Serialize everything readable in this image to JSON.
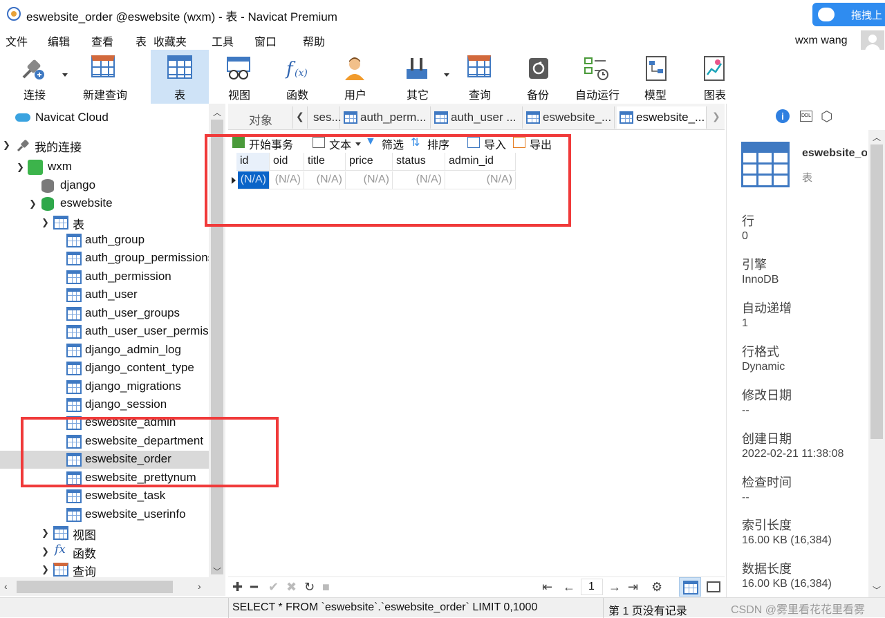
{
  "window": {
    "title": "eswebsite_order @eswebsite (wxm) - 表 - Navicat Premium"
  },
  "cloud_button": {
    "label": "拖拽上"
  },
  "menu": {
    "items": [
      "文件",
      "编辑",
      "查看",
      "表",
      "收藏夹",
      "工具",
      "窗口",
      "帮助"
    ]
  },
  "user": {
    "name": "wxm wang"
  },
  "toolbar": {
    "connect": "连接",
    "new_query": "新建查询",
    "table": "表",
    "view": "视图",
    "function": "函数",
    "user": "用户",
    "other": "其它",
    "query": "查询",
    "backup": "备份",
    "automation": "自动运行",
    "model": "模型",
    "chart": "图表"
  },
  "sidebar": {
    "cloud": "Navicat Cloud",
    "my_connections": "我的连接",
    "connection": "wxm",
    "db_django": "django",
    "db_eswebsite": "eswebsite",
    "tables_group": "表",
    "tables": [
      "auth_group",
      "auth_group_permissions",
      "auth_permission",
      "auth_user",
      "auth_user_groups",
      "auth_user_user_permissions",
      "django_admin_log",
      "django_content_type",
      "django_migrations",
      "django_session",
      "eswebsite_admin",
      "eswebsite_department",
      "eswebsite_order",
      "eswebsite_prettynum",
      "eswebsite_task",
      "eswebsite_userinfo"
    ],
    "views_group": "视图",
    "functions_group": "函数",
    "queries_group": "查询"
  },
  "tabs": {
    "objects": "对象",
    "items": [
      "ses...",
      "auth_perm...",
      "auth_user ...",
      "eswebsite_...",
      "eswebsite_..."
    ]
  },
  "grid_toolbar": {
    "begin_transaction": "开始事务",
    "text": "文本",
    "filter": "筛选",
    "sort": "排序",
    "import": "导入",
    "export": "导出"
  },
  "grid": {
    "columns": [
      "id",
      "oid",
      "title",
      "price",
      "status",
      "admin_id"
    ],
    "row": [
      "(N/A)",
      "(N/A)",
      "(N/A)",
      "(N/A)",
      "(N/A)",
      "(N/A)"
    ]
  },
  "pager": {
    "page": "1"
  },
  "status": {
    "sql": "SELECT * FROM `eswebsite`.`eswebsite_order` LIMIT 0,1000",
    "page_info": "第 1 页没有记录",
    "watermark": "CSDN @雾里看花花里看雾"
  },
  "info": {
    "name": "eswebsite_order",
    "type": "表",
    "rows_label": "行",
    "rows_value": "0",
    "engine_label": "引擎",
    "engine_value": "InnoDB",
    "auto_inc_label": "自动递增",
    "auto_inc_value": "1",
    "row_format_label": "行格式",
    "row_format_value": "Dynamic",
    "modified_label": "修改日期",
    "modified_value": "--",
    "created_label": "创建日期",
    "created_value": "2022-02-21 11:38:08",
    "check_label": "检查时间",
    "check_value": "--",
    "index_len_label": "索引长度",
    "index_len_value": "16.00 KB (16,384)",
    "data_len_label": "数据长度",
    "data_len_value": "16.00 KB (16,384)"
  },
  "colors": {
    "accent": "#3f79c2",
    "selection": "#0a64c8",
    "highlight_box": "#f03a3a"
  }
}
